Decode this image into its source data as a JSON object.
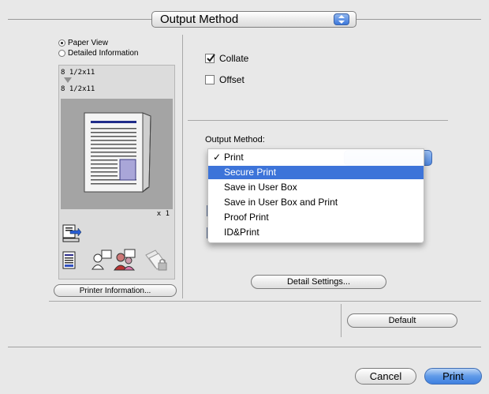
{
  "header": {
    "popup_label": "Output Method"
  },
  "view": {
    "paper_view": "Paper View",
    "detailed_info": "Detailed Information"
  },
  "preview": {
    "paper_size_1": "8 1/2x11",
    "paper_size_2": "8 1/2x11",
    "copies": "x 1"
  },
  "buttons": {
    "printer_info": "Printer Information...",
    "detail_settings": "Detail Settings...",
    "default": "Default",
    "cancel": "Cancel",
    "print": "Print"
  },
  "options": {
    "collate": "Collate",
    "offset": "Offset"
  },
  "output_method": {
    "label": "Output Method:",
    "items": [
      "Print",
      "Secure Print",
      "Save in User Box",
      "Save in User Box and Print",
      "Proof Print",
      "ID&Print"
    ],
    "checked": "Print",
    "highlighted": "Secure Print"
  }
}
